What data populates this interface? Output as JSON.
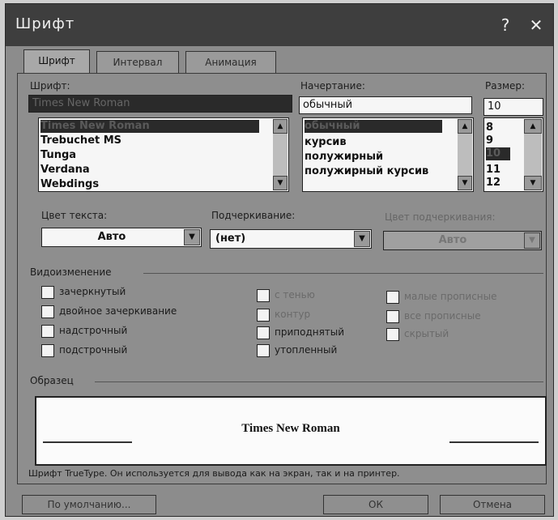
{
  "window": {
    "title": "Шрифт",
    "help_glyph": "?",
    "close_glyph": "✕"
  },
  "tabs": [
    {
      "label": "Шрифт"
    },
    {
      "label": "Интервал"
    },
    {
      "label": "Анимация"
    }
  ],
  "font": {
    "label": "Шрифт:",
    "value": "Times New Roman",
    "list": [
      "Times New Roman",
      "Trebuchet MS",
      "Tunga",
      "Verdana",
      "Webdings"
    ],
    "selected_index": 0
  },
  "style": {
    "label": "Начертание:",
    "value": "обычный",
    "list": [
      "обычный",
      "курсив",
      "полужирный",
      "полужирный курсив"
    ],
    "selected_index": 0
  },
  "size": {
    "label": "Размер:",
    "value": "10",
    "list": [
      "8",
      "9",
      "10",
      "11",
      "12"
    ],
    "selected_index": 2
  },
  "color": {
    "label": "Цвет текста:",
    "value": "Авто"
  },
  "underline": {
    "label": "Подчеркивание:",
    "value": "(нет)"
  },
  "underline_color": {
    "label": "Цвет подчеркивания:",
    "value": "Авто"
  },
  "effects": {
    "label": "Видоизменение",
    "col1": [
      "зачеркнутый",
      "двойное зачеркивание",
      "надстрочный",
      "подстрочный"
    ],
    "col2": [
      "с тенью",
      "контур",
      "приподнятый",
      "утопленный"
    ],
    "col3": [
      "малые прописные",
      "все прописные",
      "скрытый"
    ]
  },
  "preview": {
    "label": "Образец",
    "text": "Times New Roman"
  },
  "note": "Шрифт TrueType. Он используется для вывода как на экран, так и на принтер.",
  "buttons": {
    "default": "По умолчанию...",
    "ok": "ОК",
    "cancel": "Отмена"
  },
  "icons": {
    "scroll_up": "up-arrow-icon",
    "scroll_down": "down-arrow-icon",
    "dropdown": "dropdown-arrow-icon"
  }
}
